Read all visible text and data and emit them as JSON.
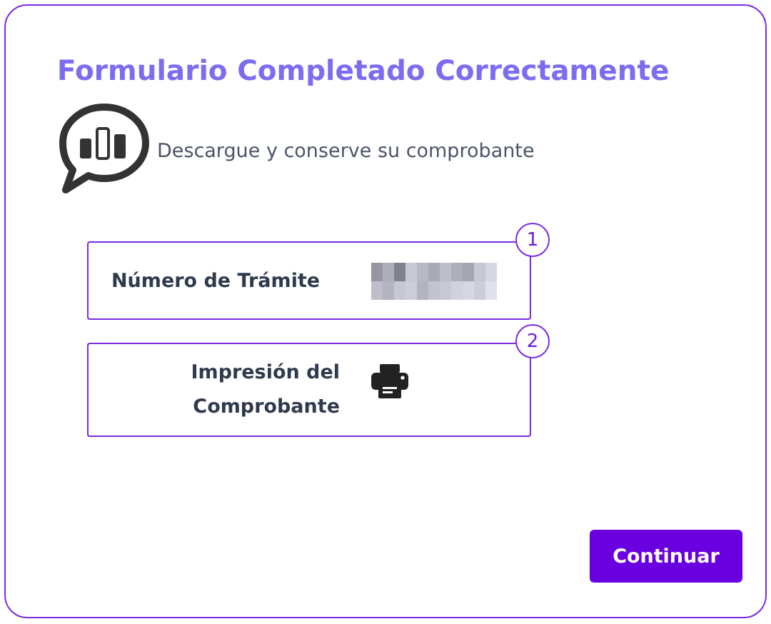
{
  "title": "Formulario Completado Correctamente",
  "subtitle": "Descargue y conserve su comprobante",
  "steps": [
    {
      "number": "1",
      "kind": "tramite",
      "label": "Número de Trámite"
    },
    {
      "number": "2",
      "kind": "print",
      "label": "Impresión del Comprobante"
    }
  ],
  "button": "Continuar"
}
